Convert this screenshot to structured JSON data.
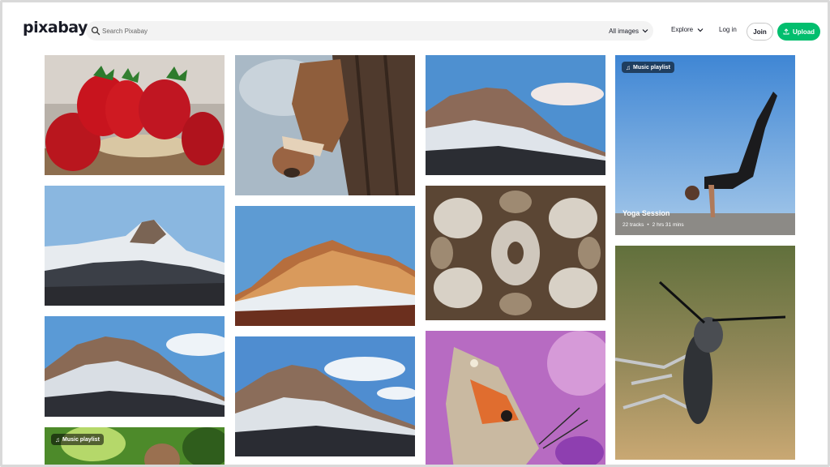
{
  "brand": {
    "logo_text": "pixabay"
  },
  "search": {
    "placeholder": "Search Pixabay",
    "filter_label": "All images"
  },
  "nav": {
    "explore_label": "Explore",
    "login_label": "Log in",
    "join_label": "Join",
    "upload_label": "Upload"
  },
  "colors": {
    "accent": "#02be6e",
    "text": "#191b26",
    "search_bg": "#f3f3f3"
  },
  "icons": {
    "search": "search-icon",
    "chevron": "chevron-down-icon",
    "upload": "upload-icon",
    "music": "music-note-icon"
  },
  "tiles": {
    "strawberries": {
      "subject": "strawberries"
    },
    "squirrel": {
      "subject": "squirrel"
    },
    "mountain_top": {
      "subject": "mountain"
    },
    "yoga": {
      "badge": "Music playlist",
      "title": "Yoga Session",
      "tracks": "22 tracks",
      "separator": "•",
      "duration": "2 hrs 31 mins"
    },
    "mountain_left": {
      "subject": "mountain"
    },
    "mountain_mid": {
      "subject": "mountain"
    },
    "kaleidoscope": {
      "subject": "kaleidoscope"
    },
    "mountain_left2": {
      "subject": "mountain"
    },
    "mountain_mid2": {
      "subject": "mountain"
    },
    "butterfly": {
      "subject": "butterfly"
    },
    "insect": {
      "subject": "insect"
    },
    "music_bottom": {
      "badge": "Music playlist"
    }
  }
}
